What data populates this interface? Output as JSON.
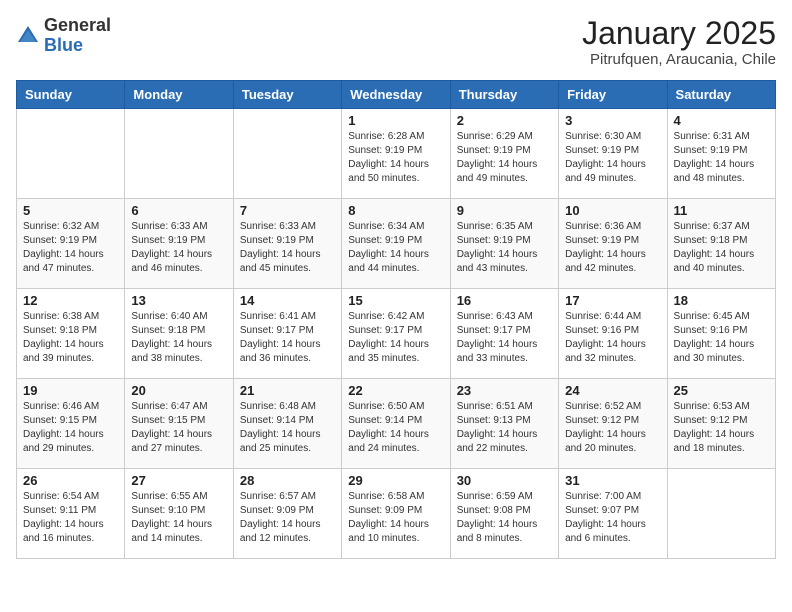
{
  "logo": {
    "general": "General",
    "blue": "Blue"
  },
  "title": "January 2025",
  "location": "Pitrufquen, Araucania, Chile",
  "weekdays": [
    "Sunday",
    "Monday",
    "Tuesday",
    "Wednesday",
    "Thursday",
    "Friday",
    "Saturday"
  ],
  "weeks": [
    [
      {
        "day": "",
        "info": ""
      },
      {
        "day": "",
        "info": ""
      },
      {
        "day": "",
        "info": ""
      },
      {
        "day": "1",
        "info": "Sunrise: 6:28 AM\nSunset: 9:19 PM\nDaylight: 14 hours and 50 minutes."
      },
      {
        "day": "2",
        "info": "Sunrise: 6:29 AM\nSunset: 9:19 PM\nDaylight: 14 hours and 49 minutes."
      },
      {
        "day": "3",
        "info": "Sunrise: 6:30 AM\nSunset: 9:19 PM\nDaylight: 14 hours and 49 minutes."
      },
      {
        "day": "4",
        "info": "Sunrise: 6:31 AM\nSunset: 9:19 PM\nDaylight: 14 hours and 48 minutes."
      }
    ],
    [
      {
        "day": "5",
        "info": "Sunrise: 6:32 AM\nSunset: 9:19 PM\nDaylight: 14 hours and 47 minutes."
      },
      {
        "day": "6",
        "info": "Sunrise: 6:33 AM\nSunset: 9:19 PM\nDaylight: 14 hours and 46 minutes."
      },
      {
        "day": "7",
        "info": "Sunrise: 6:33 AM\nSunset: 9:19 PM\nDaylight: 14 hours and 45 minutes."
      },
      {
        "day": "8",
        "info": "Sunrise: 6:34 AM\nSunset: 9:19 PM\nDaylight: 14 hours and 44 minutes."
      },
      {
        "day": "9",
        "info": "Sunrise: 6:35 AM\nSunset: 9:19 PM\nDaylight: 14 hours and 43 minutes."
      },
      {
        "day": "10",
        "info": "Sunrise: 6:36 AM\nSunset: 9:19 PM\nDaylight: 14 hours and 42 minutes."
      },
      {
        "day": "11",
        "info": "Sunrise: 6:37 AM\nSunset: 9:18 PM\nDaylight: 14 hours and 40 minutes."
      }
    ],
    [
      {
        "day": "12",
        "info": "Sunrise: 6:38 AM\nSunset: 9:18 PM\nDaylight: 14 hours and 39 minutes."
      },
      {
        "day": "13",
        "info": "Sunrise: 6:40 AM\nSunset: 9:18 PM\nDaylight: 14 hours and 38 minutes."
      },
      {
        "day": "14",
        "info": "Sunrise: 6:41 AM\nSunset: 9:17 PM\nDaylight: 14 hours and 36 minutes."
      },
      {
        "day": "15",
        "info": "Sunrise: 6:42 AM\nSunset: 9:17 PM\nDaylight: 14 hours and 35 minutes."
      },
      {
        "day": "16",
        "info": "Sunrise: 6:43 AM\nSunset: 9:17 PM\nDaylight: 14 hours and 33 minutes."
      },
      {
        "day": "17",
        "info": "Sunrise: 6:44 AM\nSunset: 9:16 PM\nDaylight: 14 hours and 32 minutes."
      },
      {
        "day": "18",
        "info": "Sunrise: 6:45 AM\nSunset: 9:16 PM\nDaylight: 14 hours and 30 minutes."
      }
    ],
    [
      {
        "day": "19",
        "info": "Sunrise: 6:46 AM\nSunset: 9:15 PM\nDaylight: 14 hours and 29 minutes."
      },
      {
        "day": "20",
        "info": "Sunrise: 6:47 AM\nSunset: 9:15 PM\nDaylight: 14 hours and 27 minutes."
      },
      {
        "day": "21",
        "info": "Sunrise: 6:48 AM\nSunset: 9:14 PM\nDaylight: 14 hours and 25 minutes."
      },
      {
        "day": "22",
        "info": "Sunrise: 6:50 AM\nSunset: 9:14 PM\nDaylight: 14 hours and 24 minutes."
      },
      {
        "day": "23",
        "info": "Sunrise: 6:51 AM\nSunset: 9:13 PM\nDaylight: 14 hours and 22 minutes."
      },
      {
        "day": "24",
        "info": "Sunrise: 6:52 AM\nSunset: 9:12 PM\nDaylight: 14 hours and 20 minutes."
      },
      {
        "day": "25",
        "info": "Sunrise: 6:53 AM\nSunset: 9:12 PM\nDaylight: 14 hours and 18 minutes."
      }
    ],
    [
      {
        "day": "26",
        "info": "Sunrise: 6:54 AM\nSunset: 9:11 PM\nDaylight: 14 hours and 16 minutes."
      },
      {
        "day": "27",
        "info": "Sunrise: 6:55 AM\nSunset: 9:10 PM\nDaylight: 14 hours and 14 minutes."
      },
      {
        "day": "28",
        "info": "Sunrise: 6:57 AM\nSunset: 9:09 PM\nDaylight: 14 hours and 12 minutes."
      },
      {
        "day": "29",
        "info": "Sunrise: 6:58 AM\nSunset: 9:09 PM\nDaylight: 14 hours and 10 minutes."
      },
      {
        "day": "30",
        "info": "Sunrise: 6:59 AM\nSunset: 9:08 PM\nDaylight: 14 hours and 8 minutes."
      },
      {
        "day": "31",
        "info": "Sunrise: 7:00 AM\nSunset: 9:07 PM\nDaylight: 14 hours and 6 minutes."
      },
      {
        "day": "",
        "info": ""
      }
    ]
  ]
}
